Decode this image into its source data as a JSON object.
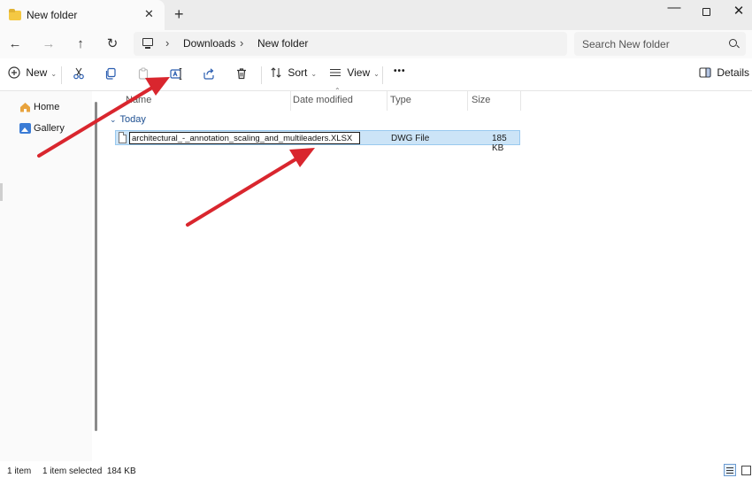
{
  "window": {
    "tab_title": "New folder",
    "close_tab_glyph": "✕",
    "new_tab_glyph": "+",
    "minimize_glyph": "—",
    "close_glyph": "✕"
  },
  "nav": {
    "back_glyph": "←",
    "forward_glyph": "→",
    "up_glyph": "↑",
    "refresh_glyph": "↻"
  },
  "breadcrumb": {
    "sep_glyph": "›",
    "items": [
      "Downloads",
      "New folder"
    ]
  },
  "search": {
    "placeholder": "Search New folder"
  },
  "toolbar": {
    "new_label": "New",
    "sort_label": "Sort",
    "view_label": "View",
    "more_glyph": "•••",
    "details_label": "Details",
    "chevron_glyph": "⌄",
    "icons": [
      "add-icon",
      "cut-icon",
      "copy-icon",
      "paste-icon",
      "rename-icon",
      "share-icon",
      "delete-icon",
      "sort-icon",
      "view-icon",
      "details-pane-icon"
    ]
  },
  "sidebar": {
    "items": [
      {
        "label": "Home",
        "icon": "home-icon"
      },
      {
        "label": "Gallery",
        "icon": "gallery-icon"
      }
    ]
  },
  "columns": {
    "name": "Name",
    "date_modified": "Date modified",
    "type": "Type",
    "size": "Size"
  },
  "groups": [
    {
      "header": "Today",
      "chevron_glyph": "⌄",
      "files": [
        {
          "name": "architectural_-_annotation_scaling_and_multileaders.XLSX",
          "date_modified": "",
          "type": "DWG File",
          "size": "185 KB",
          "selected": true,
          "renaming": true
        }
      ]
    }
  ],
  "status": {
    "item_count": "1 item",
    "selection": "1 item selected  184 KB"
  },
  "annotations": {
    "arrow_color": "#d9262e",
    "arrow_count": 2
  },
  "colors": {
    "accent": "#2a5db0",
    "selection_bg": "#cce4f7",
    "selection_border": "#99c9ef",
    "group_header": "#1d4f91"
  }
}
